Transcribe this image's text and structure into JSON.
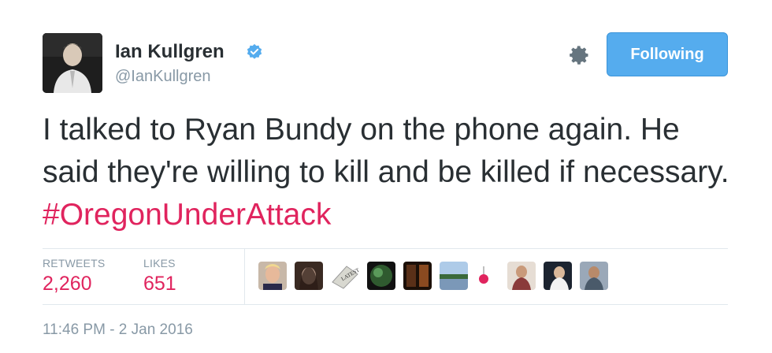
{
  "user": {
    "name": "Ian Kullgren",
    "handle": "@IanKullgren",
    "verified": true,
    "avatar_icon": "user-avatar-photo"
  },
  "actions": {
    "follow_label": "Following",
    "settings_icon": "gear-icon"
  },
  "tweet": {
    "text": "I talked to Ryan Bundy on the phone again. He said they're willing to kill and be killed if necessary. ",
    "hashtag": "#OregonUnderAttack"
  },
  "stats": {
    "retweets_label": "RETWEETS",
    "retweets_value": "2,260",
    "likes_label": "LIKES",
    "likes_value": "651"
  },
  "likers": [
    {
      "icon": "liker-avatar-1",
      "color": "#c8b8a8"
    },
    {
      "icon": "liker-avatar-2",
      "color": "#3a2a22"
    },
    {
      "icon": "liker-avatar-3",
      "color": "#d8d8d0"
    },
    {
      "icon": "liker-avatar-4",
      "color": "#2f5a2f"
    },
    {
      "icon": "liker-avatar-5",
      "color": "#5a3018"
    },
    {
      "icon": "liker-avatar-6",
      "color": "#7b98b8"
    },
    {
      "icon": "liker-avatar-7",
      "color": "#e0245e"
    },
    {
      "icon": "liker-avatar-8",
      "color": "#8a3a3a"
    },
    {
      "icon": "liker-avatar-9",
      "color": "#1c2430"
    },
    {
      "icon": "liker-avatar-10",
      "color": "#9aa8b8"
    }
  ],
  "timestamp": "11:46 PM - 2 Jan 2016",
  "colors": {
    "accent": "#55acee",
    "hashtag": "#e0245e",
    "muted": "#8899a6",
    "text": "#292f33"
  }
}
